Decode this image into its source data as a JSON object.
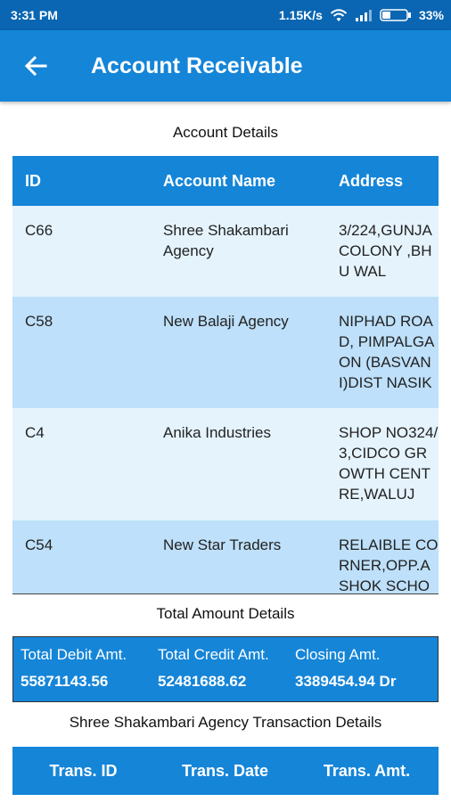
{
  "status": {
    "time": "3:31 PM",
    "speed": "1.15K/s",
    "battery": "33%",
    "icons": [
      "wifi-icon",
      "signal-icon",
      "battery-icon"
    ]
  },
  "app_bar": {
    "title": "Account Receivable",
    "back_icon": "arrow-left-icon"
  },
  "account_details": {
    "title": "Account Details",
    "columns": [
      "ID",
      "Account Name",
      "Address"
    ],
    "rows": [
      {
        "id": "C66",
        "name": "Shree Shakambari Agency",
        "address": "3/224,GUNJA COLONY ,BHU WAL"
      },
      {
        "id": "C58",
        "name": "New Balaji Agency",
        "address": "NIPHAD ROAD, PIMPALGAON (BASVANI)DIST NASIK"
      },
      {
        "id": "C4",
        "name": "Anika Industries",
        "address": "SHOP NO324/3,CIDCO GROWTH CENTRE,WALUJ"
      },
      {
        "id": "C54",
        "name": "New Star Traders",
        "address": "RELAIBLE CORNER,OPP.ASHOK SCHOOL,PAKHAL"
      }
    ]
  },
  "total_amount": {
    "title": "Total Amount Details",
    "labels": [
      "Total Debit Amt.",
      "Total Credit Amt.",
      "Closing Amt."
    ],
    "values": [
      "55871143.56",
      "52481688.62",
      "3389454.94 Dr"
    ]
  },
  "transactions": {
    "title": "Shree Shakambari Agency Transaction Details",
    "columns": [
      "Trans. ID",
      "Trans. Date",
      "Trans. Amt."
    ]
  },
  "colors": {
    "status_bar": "#0a66b2",
    "primary": "#1585d8",
    "row_light": "#e5f3fd",
    "row_dark": "#bee0fa"
  }
}
